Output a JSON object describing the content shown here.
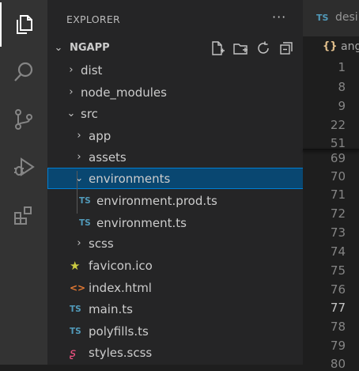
{
  "sidebar": {
    "title": "EXPLORER",
    "more_label": "···",
    "project": {
      "label": "NGAPP"
    },
    "tree": [
      {
        "kind": "folder",
        "label": "dist"
      },
      {
        "kind": "folder",
        "label": "node_modules"
      },
      {
        "kind": "folder-open",
        "label": "src"
      },
      {
        "kind": "folder",
        "label": "app"
      },
      {
        "kind": "folder",
        "label": "assets"
      },
      {
        "kind": "folder-open",
        "label": "environments",
        "selected": true
      },
      {
        "kind": "ts",
        "label": "environment.prod.ts"
      },
      {
        "kind": "ts",
        "label": "environment.ts"
      },
      {
        "kind": "folder",
        "label": "scss"
      },
      {
        "kind": "favicon",
        "label": "favicon.ico"
      },
      {
        "kind": "html",
        "label": "index.html"
      },
      {
        "kind": "ts",
        "label": "main.ts"
      },
      {
        "kind": "ts",
        "label": "polyfills.ts"
      },
      {
        "kind": "scss",
        "label": "styles.scss"
      }
    ]
  },
  "editor": {
    "tab": {
      "badge": "TS",
      "name": "desi"
    },
    "breadcrumb": {
      "icon": "{}",
      "text": "ang"
    },
    "sticky_line_numbers": [
      "1",
      "8",
      "9",
      "22",
      "51"
    ],
    "line_numbers": [
      "69",
      "70",
      "71",
      "72",
      "73",
      "74",
      "75",
      "76",
      "77",
      "78",
      "79",
      "80"
    ],
    "current_line": "77"
  },
  "activity_bar": {
    "icons": [
      "files-icon",
      "search-icon",
      "source-control-icon",
      "run-debug-icon",
      "extensions-icon"
    ]
  },
  "colors": {
    "activity_bg": "#333333",
    "sidebar_bg": "#252526",
    "editor_bg": "#1e1e1e",
    "selection_bg": "#094771",
    "selection_border": "#007fd4",
    "ts_blue": "#519aba",
    "favicon_yellow": "#cbcb41",
    "html_orange": "#e37933",
    "scss_pink": "#f55385"
  }
}
